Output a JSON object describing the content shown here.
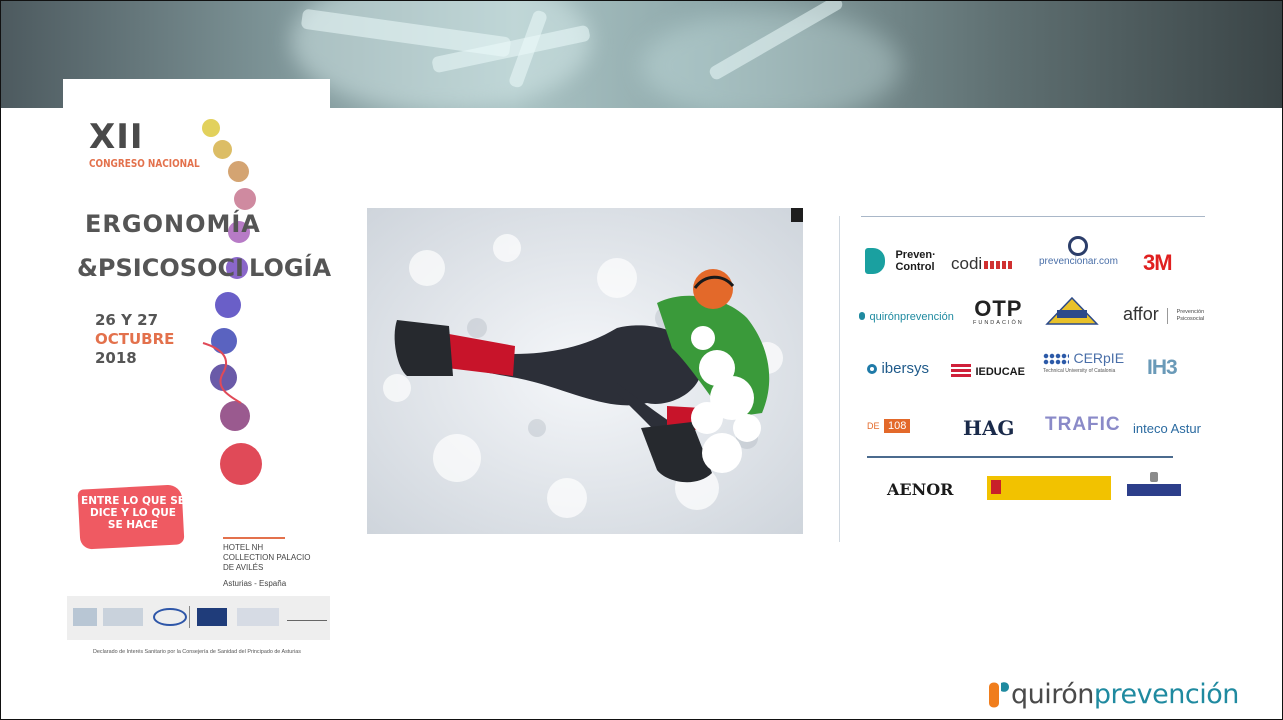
{
  "poster": {
    "roman": "XII",
    "congreso": "CONGRESO NACIONAL",
    "title_line1": "ERGONOMÍA",
    "title_line2a": "&PSICOSOCI",
    "title_line2b": "LOGÍA",
    "dates": "26 Y 27",
    "month": "OCTUBRE",
    "year": "2018",
    "slogan": "ENTRE LO QUE SE DICE Y LO QUE SE HACE",
    "hotel": "HOTEL NH\nCOLLECTION PALACIO\nDE AVILÉS",
    "place": "Asturias - España",
    "footer": "Declarado de Interés Sanitario por la Consejería de Sanidad del Principado de Asturias",
    "accent_color": "#e3714c"
  },
  "photo": {
    "icon": "climber-in-snow-photo"
  },
  "sponsors": {
    "row1": [
      "Preven· Control",
      "codi",
      "prevencionar.com",
      "3M"
    ],
    "row2": [
      "quirónprevención",
      "OTP",
      "affor"
    ],
    "row3": [
      "ibersys",
      "IEDUCAE",
      "CERpIE",
      "IH3"
    ],
    "row4": [
      "DE",
      "108",
      "HAG",
      "TRAFIC",
      "inteco Astur"
    ],
    "row5": [
      "AENOR"
    ],
    "otp_sub": "FUNDACIÓN",
    "affor_sub": "Prevención Psicosocial",
    "cerpie_sub": "Technical University of Catalonia"
  },
  "brand": {
    "name_a": "quirón",
    "name_b": "prevención",
    "color_a": "#4a4a4a",
    "color_b": "#1f8aa0",
    "logo_orange": "#f07d1c",
    "logo_teal": "#1f8aa0"
  }
}
